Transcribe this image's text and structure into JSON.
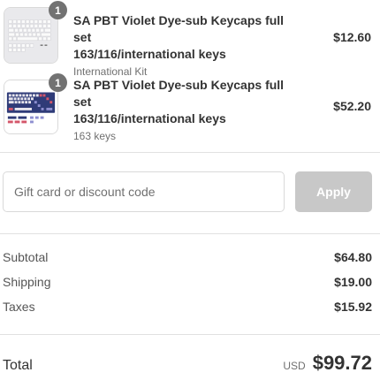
{
  "items": [
    {
      "title_line1": "SA PBT Violet Dye-sub Keycaps full set",
      "title_line2": "163/116/international keys",
      "variant": "International Kit",
      "price": "$12.60",
      "quantity": "1",
      "thumbnail": "white-keycap-set-image"
    },
    {
      "title_line1": "SA PBT Violet Dye-sub Keycaps full set",
      "title_line2": "163/116/international keys",
      "variant": "163 keys",
      "price": "$52.20",
      "quantity": "1",
      "thumbnail": "violet-keycap-set-image"
    }
  ],
  "discount": {
    "placeholder": "Gift card or discount code",
    "value": "",
    "apply_label": "Apply"
  },
  "summary": {
    "subtotal_label": "Subtotal",
    "subtotal_value": "$64.80",
    "shipping_label": "Shipping",
    "shipping_value": "$19.00",
    "taxes_label": "Taxes",
    "taxes_value": "$15.92"
  },
  "total": {
    "label": "Total",
    "currency": "USD",
    "amount": "$99.72"
  },
  "colors": {
    "badge": "#727272",
    "apply_disabled": "#c8c8c8",
    "border": "#d9d9d9",
    "text": "#333333"
  }
}
